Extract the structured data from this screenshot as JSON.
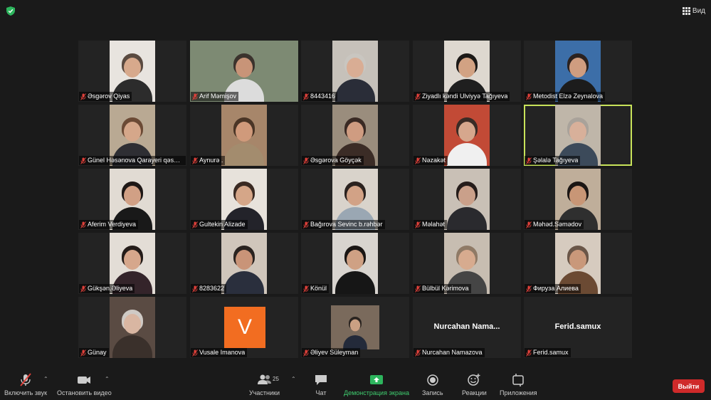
{
  "header": {
    "view_label": "Вид"
  },
  "participants": [
    {
      "name": "Əsgərov Qiyas",
      "bg": "#e8e4df",
      "skin": "#d7a98c",
      "hair": "#5a4a40",
      "cloth": "#2c2c2c"
    },
    {
      "name": "Arif  Məmişov",
      "bg": "#7d8a73",
      "skin": "#c89478",
      "hair": "#3b332d",
      "cloth": "#dcdcdc",
      "wide": true
    },
    {
      "name": "8443416",
      "bg": "#c6c1ba",
      "skin": "#d9ad94",
      "hair": "#c9c6c0",
      "cloth": "#2a2d38"
    },
    {
      "name": "Ziyadlı kəndi  Ulviyyə Tağıyeva",
      "bg": "#ded8d0",
      "skin": "#d2a283",
      "hair": "#1c1917",
      "cloth": "#1f1f1f"
    },
    {
      "name": "Metodist Elzə Zeynalova",
      "bg": "#3c6ea8",
      "skin": "#cf9d80",
      "hair": "#2b2220",
      "cloth": "#1c1c1c"
    },
    {
      "name": "Günel Həsənova Qarayeri qəsəbə",
      "bg": "#b9a993",
      "skin": "#d5a78a",
      "hair": "#6b4a35",
      "cloth": "#2e2e33"
    },
    {
      "name": "Aynurə .",
      "bg": "#a7866a",
      "skin": "#d09a7b",
      "hair": "#4a3526",
      "cloth": "#a38c6e"
    },
    {
      "name": "Əsgərova Göyçək",
      "bg": "#9a8d7d",
      "skin": "#cf9c81",
      "hair": "#3a2a24",
      "cloth": "#3b2c26"
    },
    {
      "name": "Nəzakət",
      "bg": "#c24a36",
      "skin": "#d6a78d",
      "hair": "#3a2b25",
      "cloth": "#f0f0f0"
    },
    {
      "name": "Şəlalə Tağıyeva",
      "bg": "#bfb6a9",
      "skin": "#d8b09a",
      "hair": "#a9a29a",
      "cloth": "#3c4a5a",
      "active": true
    },
    {
      "name": "Aferim Verdiyeva",
      "bg": "#e1dbd3",
      "skin": "#d1a085",
      "hair": "#1e1816",
      "cloth": "#191919"
    },
    {
      "name": "Gultekin Alizade",
      "bg": "#e7e2db",
      "skin": "#d5a688",
      "hair": "#3a2a22",
      "cloth": "#23232a"
    },
    {
      "name": "Bağırova Sevinc b.rəhbər",
      "bg": "#d9d3cb",
      "skin": "#d2a286",
      "hair": "#2b221f",
      "cloth": "#9aa7b3"
    },
    {
      "name": "Məlahət",
      "bg": "#c9c0b6",
      "skin": "#caa08a",
      "hair": "#251c1a",
      "cloth": "#2a2a2e"
    },
    {
      "name": "Məhəd.Səmədov",
      "bg": "#bfae9a",
      "skin": "#c89676",
      "hair": "#1b1614",
      "cloth": "#2f2f2f"
    },
    {
      "name": "Gükşən.Əliyeva",
      "bg": "#e3ddd6",
      "skin": "#d6a78c",
      "hair": "#241c19",
      "cloth": "#34242a"
    },
    {
      "name": "8283622",
      "bg": "#d0c6bb",
      "skin": "#c99478",
      "hair": "#2a2320",
      "cloth": "#2a2f3d"
    },
    {
      "name": "Könül",
      "bg": "#d8d4cf",
      "skin": "#cfa184",
      "hair": "#1a1614",
      "cloth": "#161616"
    },
    {
      "name": "Bülbül Kərimova",
      "bg": "#c7bdb1",
      "skin": "#d7ab8f",
      "hair": "#8f7a66",
      "cloth": "#454545"
    },
    {
      "name": "Фируза Алиева",
      "bg": "#d6cbbf",
      "skin": "#c9987a",
      "hair": "#6a5648",
      "cloth": "#6b4a33"
    },
    {
      "name": "Günay",
      "bg": "#5a4b43",
      "skin": "#d9b6a2",
      "hair": "#cfcac5",
      "cloth": "#3a302b"
    },
    {
      "name": "Vusale Imanova",
      "avatar_letter": "V"
    },
    {
      "name": "Əliyev Süleyman",
      "bg": "#7a6a5c",
      "skin": "#caa083",
      "hair": "#2a2420",
      "cloth": "#232a3a",
      "small": true
    },
    {
      "name": "Nurcahan Namazova",
      "display_name": "Nurcahan  Nama..."
    },
    {
      "name": "Ferid.samux",
      "display_name": "Ferid.samux"
    }
  ],
  "toolbar": {
    "mute_label": "Включить звук",
    "video_label": "Остановить видео",
    "participants_label": "Участники",
    "participants_count": "25",
    "chat_label": "Чат",
    "share_label": "Демонстрация экрана",
    "record_label": "Запись",
    "reactions_label": "Реакции",
    "apps_label": "Приложения",
    "leave_label": "Выйти"
  }
}
